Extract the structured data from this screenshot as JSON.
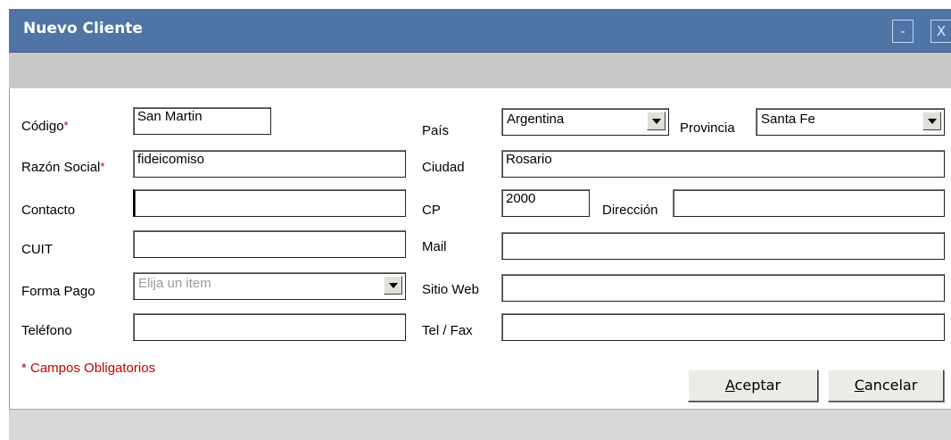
{
  "window": {
    "title": "Nuevo Cliente",
    "minimize": "-",
    "close": "X"
  },
  "form": {
    "codigo": {
      "label": "Código",
      "value": "San Martin"
    },
    "razon_social": {
      "label": "Razón Social",
      "value": "fideicomiso"
    },
    "contacto": {
      "label": "Contacto",
      "value": ""
    },
    "cuit": {
      "label": "CUIT",
      "value": ""
    },
    "forma_pago": {
      "label": "Forma Pago",
      "placeholder": "Elija un item"
    },
    "telefono": {
      "label": "Teléfono",
      "value": ""
    },
    "pais": {
      "label": "País",
      "value": "Argentina"
    },
    "provincia": {
      "label": "Provincia",
      "value": "Santa Fe"
    },
    "ciudad": {
      "label": "Ciudad",
      "value": "Rosario"
    },
    "cp": {
      "label": "CP",
      "value": "2000"
    },
    "direccion": {
      "label": "Dirección",
      "value": ""
    },
    "mail": {
      "label": "Mail",
      "value": ""
    },
    "sitio_web": {
      "label": "Sitio Web",
      "value": ""
    },
    "tel_fax": {
      "label": "Tel / Fax",
      "value": ""
    },
    "required_mark": "*",
    "required_note": "* Campos Obligatorios"
  },
  "buttons": {
    "accept_mnemonic": "A",
    "accept_rest": "ceptar",
    "cancel_mnemonic": "C",
    "cancel_rest": "ancelar"
  },
  "colors": {
    "titlebar": "#4e75a5",
    "required": "#c00000",
    "toolbar": "#c8c8c8"
  }
}
